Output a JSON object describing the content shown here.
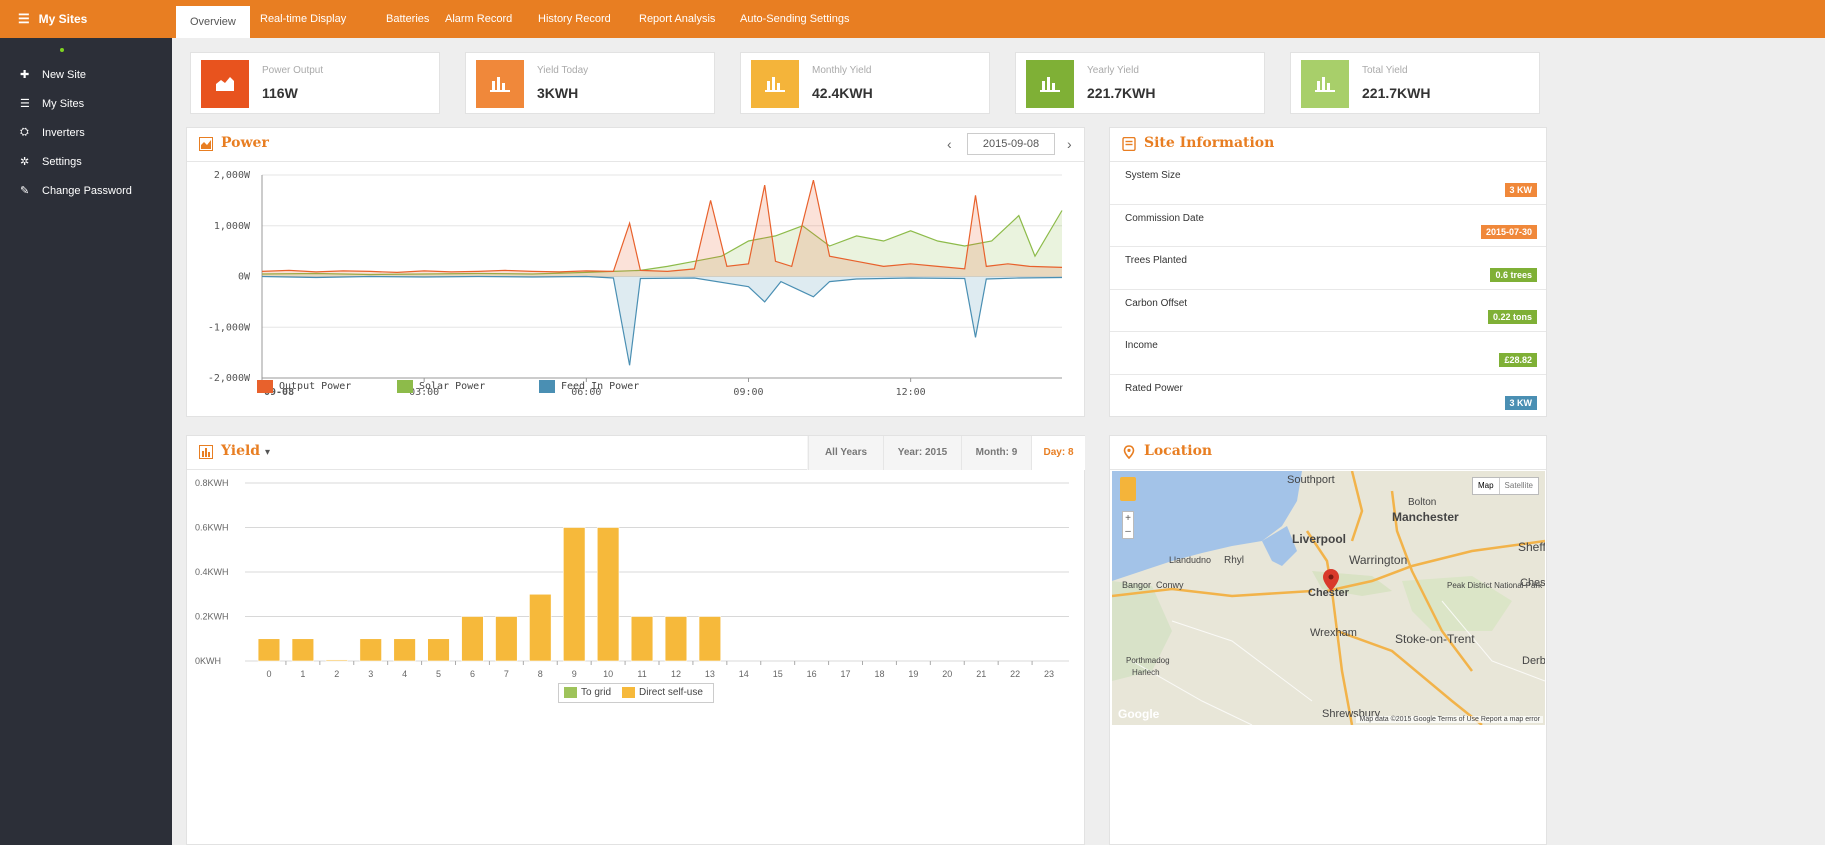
{
  "sidebar": {
    "brand": "My Sites",
    "items": [
      {
        "label": "New Site",
        "icon": "plus-icon"
      },
      {
        "label": "My Sites",
        "icon": "list-icon"
      },
      {
        "label": "Inverters",
        "icon": "inverter-icon"
      },
      {
        "label": "Settings",
        "icon": "gear-icon"
      },
      {
        "label": "Change Password",
        "icon": "edit-icon"
      }
    ]
  },
  "tabs": [
    "Overview",
    "Real-time Display",
    "Batteries",
    "Alarm Record",
    "History Record",
    "Report Analysis",
    "Auto-Sending Settings"
  ],
  "kpis": [
    {
      "label": "Power Output",
      "value": "116W",
      "color": "#e8531e"
    },
    {
      "label": "Yield Today",
      "value": "3KWH",
      "color": "#f0883a"
    },
    {
      "label": "Monthly Yield",
      "value": "42.4KWH",
      "color": "#f4b43a"
    },
    {
      "label": "Yearly Yield",
      "value": "221.7KWH",
      "color": "#7fb036"
    },
    {
      "label": "Total Yield",
      "value": "221.7KWH",
      "color": "#a8cf6a"
    }
  ],
  "power": {
    "title": "Power",
    "date": "2015-09-08",
    "legend": [
      "Output Power",
      "Solar Power",
      "Feed In Power"
    ]
  },
  "site_info": {
    "title": "Site Information",
    "rows": [
      {
        "key": "System Size",
        "value": "3 KW",
        "color": "#f0883a"
      },
      {
        "key": "Commission Date",
        "value": "2015-07-30",
        "color": "#f0883a"
      },
      {
        "key": "Trees Planted",
        "value": "0.6 trees",
        "color": "#7fb036"
      },
      {
        "key": "Carbon Offset",
        "value": "0.22 tons",
        "color": "#7fb036"
      },
      {
        "key": "Income",
        "value": "£28.82",
        "color": "#7fb036"
      },
      {
        "key": "Rated Power",
        "value": "3 KW",
        "color": "#4a8fb3"
      }
    ]
  },
  "yield": {
    "title": "Yield",
    "tabs": [
      "All Years",
      "Year: 2015",
      "Month: 9",
      "Day: 8"
    ],
    "active_tab": 3
  },
  "location": {
    "title": "Location",
    "map_buttons": [
      "Map",
      "Satellite"
    ],
    "places": [
      "Southport",
      "Bolton",
      "Manchester",
      "Liverpool",
      "Sheff",
      "Warrington",
      "Llandudno",
      "Rhyl",
      "Bangor",
      "Conwy",
      "Chester",
      "Peak District National Park",
      "Chest",
      "Wrexham",
      "Stoke-on-Trent",
      "Derb",
      "Porthmadog",
      "Harlech",
      "Shrewsbury"
    ],
    "attribution": "Map data ©2015 Google   Terms of Use   Report a map error",
    "google": "Google"
  },
  "chart_data": [
    {
      "type": "line",
      "ylim": [
        -2000,
        2000
      ],
      "yticks": [
        "2,000W",
        "1,000W",
        "0W",
        "-1,000W",
        "-2,000W"
      ],
      "xticks": [
        "09-08",
        "03:00",
        "06:00",
        "09:00",
        "12:00"
      ],
      "x_hours": [
        0,
        3,
        6,
        9,
        12
      ],
      "xrange_hours": [
        0,
        14.8
      ],
      "series": [
        {
          "name": "Output Power",
          "color": "#e8612c",
          "points": [
            [
              0,
              100
            ],
            [
              0.5,
              120
            ],
            [
              1,
              90
            ],
            [
              1.5,
              110
            ],
            [
              2,
              100
            ],
            [
              2.5,
              80
            ],
            [
              3,
              110
            ],
            [
              3.5,
              90
            ],
            [
              4,
              100
            ],
            [
              4.5,
              120
            ],
            [
              5,
              100
            ],
            [
              5.5,
              90
            ],
            [
              6,
              110
            ],
            [
              6.5,
              100
            ],
            [
              6.8,
              1050
            ],
            [
              7,
              120
            ],
            [
              7.5,
              100
            ],
            [
              8,
              150
            ],
            [
              8.3,
              1500
            ],
            [
              8.6,
              200
            ],
            [
              9,
              250
            ],
            [
              9.3,
              1800
            ],
            [
              9.5,
              300
            ],
            [
              9.8,
              200
            ],
            [
              10.2,
              1900
            ],
            [
              10.5,
              400
            ],
            [
              11,
              300
            ],
            [
              11.5,
              200
            ],
            [
              12,
              250
            ],
            [
              12.5,
              200
            ],
            [
              13,
              150
            ],
            [
              13.2,
              1600
            ],
            [
              13.4,
              200
            ],
            [
              13.8,
              250
            ],
            [
              14.2,
              200
            ],
            [
              14.8,
              180
            ]
          ]
        },
        {
          "name": "Solar Power",
          "color": "#8dbb4a",
          "points": [
            [
              0,
              50
            ],
            [
              1,
              60
            ],
            [
              2,
              40
            ],
            [
              3,
              50
            ],
            [
              4,
              60
            ],
            [
              5,
              50
            ],
            [
              6,
              80
            ],
            [
              6.5,
              100
            ],
            [
              7,
              120
            ],
            [
              7.5,
              200
            ],
            [
              8,
              300
            ],
            [
              8.5,
              400
            ],
            [
              9,
              700
            ],
            [
              9.5,
              800
            ],
            [
              10,
              1000
            ],
            [
              10.5,
              600
            ],
            [
              11,
              800
            ],
            [
              11.5,
              700
            ],
            [
              12,
              900
            ],
            [
              12.5,
              700
            ],
            [
              13,
              600
            ],
            [
              13.5,
              700
            ],
            [
              14,
              1200
            ],
            [
              14.3,
              400
            ],
            [
              14.8,
              1300
            ]
          ]
        },
        {
          "name": "Feed In Power",
          "color": "#4a8fb3",
          "points": [
            [
              0,
              0
            ],
            [
              1,
              -20
            ],
            [
              2,
              0
            ],
            [
              3,
              -10
            ],
            [
              4,
              0
            ],
            [
              5,
              -10
            ],
            [
              6,
              0
            ],
            [
              6.5,
              -30
            ],
            [
              6.8,
              -1750
            ],
            [
              7,
              -40
            ],
            [
              8,
              -30
            ],
            [
              9,
              -200
            ],
            [
              9.3,
              -500
            ],
            [
              9.6,
              -100
            ],
            [
              10,
              -300
            ],
            [
              10.2,
              -400
            ],
            [
              10.5,
              -100
            ],
            [
              11,
              -50
            ],
            [
              12,
              -30
            ],
            [
              13,
              -40
            ],
            [
              13.2,
              -1200
            ],
            [
              13.4,
              -50
            ],
            [
              14,
              -30
            ],
            [
              14.8,
              -20
            ]
          ]
        }
      ]
    },
    {
      "type": "bar",
      "ylim": [
        0,
        0.8
      ],
      "yticks": [
        "0.8KWH",
        "0.6KWH",
        "0.4KWH",
        "0.2KWH",
        "0KWH"
      ],
      "categories": [
        "0",
        "1",
        "2",
        "3",
        "4",
        "5",
        "6",
        "7",
        "8",
        "9",
        "10",
        "11",
        "12",
        "13",
        "14",
        "15",
        "16",
        "17",
        "18",
        "19",
        "20",
        "21",
        "22",
        "23"
      ],
      "series": [
        {
          "name": "To grid",
          "color": "#9ec35a",
          "values": [
            0,
            0,
            0,
            0,
            0,
            0,
            0,
            0,
            0,
            0,
            0,
            0,
            0,
            0,
            0,
            0,
            0,
            0,
            0,
            0,
            0,
            0,
            0,
            0
          ]
        },
        {
          "name": "Direct self-use",
          "color": "#f6b93b",
          "values": [
            0.1,
            0.1,
            0.005,
            0.1,
            0.1,
            0.1,
            0.2,
            0.2,
            0.3,
            0.6,
            0.6,
            0.2,
            0.2,
            0.2,
            0,
            0,
            0,
            0,
            0,
            0,
            0,
            0,
            0,
            0
          ]
        }
      ]
    }
  ]
}
